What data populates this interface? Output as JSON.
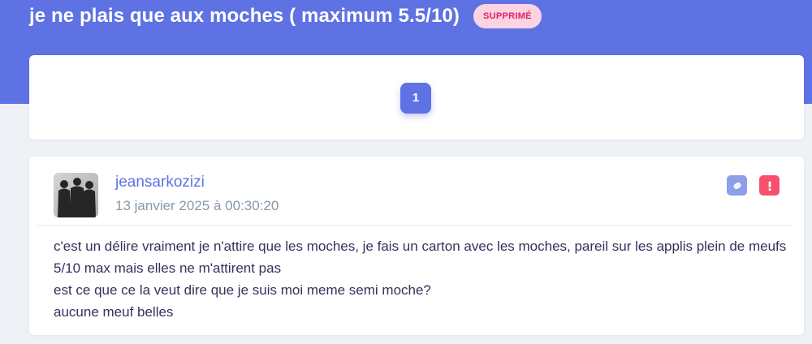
{
  "topic": {
    "title": "je ne plais que aux moches ( maximum 5.5/10)",
    "status_badge": "SUPPRIMÉ"
  },
  "pagination": {
    "current_page": "1"
  },
  "post": {
    "author": "jeansarkozizi",
    "date": "13 janvier 2025 à 00:30:20",
    "avatar_icon": "user-photo-avatar",
    "actions": {
      "link_icon": "link-icon",
      "report_icon": "exclamation-icon"
    },
    "body_lines": [
      "c'est un délire vraiment je n'attire que les moches, je fais un carton avec les moches, pareil sur les applis plein de meufs 5/10 max mais elles ne m'attirent pas",
      "est ce que ce la veut dire que je suis moi meme semi moche?",
      "aucune meuf belles"
    ]
  },
  "colors": {
    "primary": "#5e72e4",
    "badge_bg": "#fbd3e2",
    "badge_text": "#e0205e",
    "danger": "#f5516f",
    "link_btn": "#8f9ee9",
    "muted_text": "#8898aa",
    "body_text": "#32325d",
    "page_bg": "#eef1f6"
  }
}
